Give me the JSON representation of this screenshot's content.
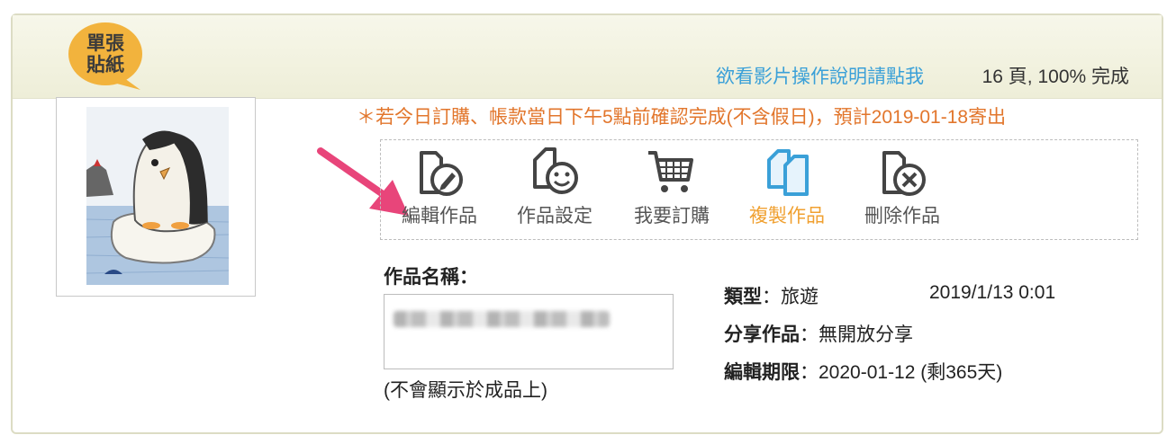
{
  "header": {
    "badge_text": "單張\n貼紙",
    "tutorial_link": "欲看影片操作說明請點我",
    "progress": "16 頁, 100% 完成"
  },
  "notice": "＊若今日訂購、帳款當日下午5點前確認完成(不含假日)，預計2019-01-18寄出",
  "toolbar": {
    "edit_label": "編輯作品",
    "settings_label": "作品設定",
    "order_label": "我要訂購",
    "copy_label": "複製作品",
    "delete_label": "刪除作品"
  },
  "work": {
    "name_label": "作品名稱：",
    "name_value": "",
    "name_note": "(不會顯示於成品上)",
    "type_label": "類型",
    "type_value": "旅遊",
    "datetime": "2019/1/13 0:01",
    "share_label": "分享作品",
    "share_value": "無開放分享",
    "deadline_label": "編輯期限",
    "deadline_value": "2020-01-12 (剩365天)",
    "colon": "："
  },
  "colors": {
    "link": "#3aa0d8",
    "notice": "#e2762c",
    "copy_accent": "#f0a030",
    "badge": "#f2b33d",
    "arrow": "#e8457a"
  }
}
